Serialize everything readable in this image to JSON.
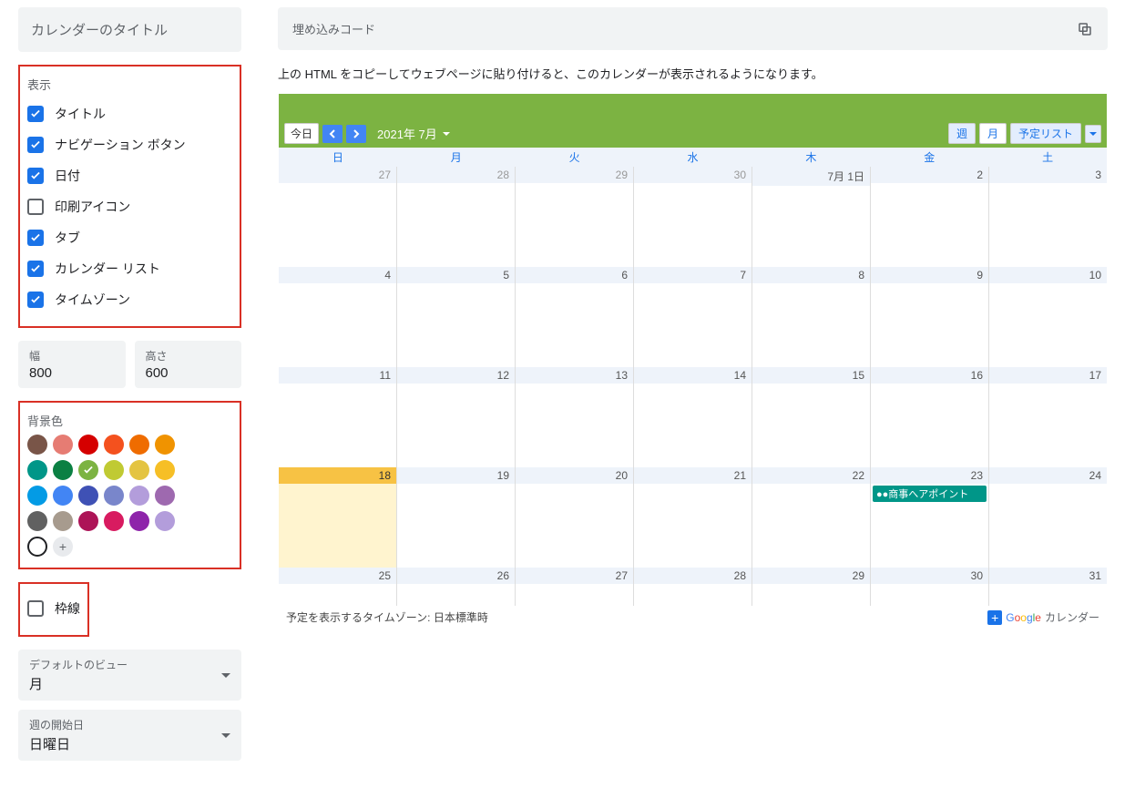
{
  "sidebar": {
    "title_placeholder": "カレンダーのタイトル",
    "display": {
      "heading": "表示",
      "options": [
        {
          "label": "タイトル",
          "checked": true
        },
        {
          "label": "ナビゲーション ボタン",
          "checked": true
        },
        {
          "label": "日付",
          "checked": true
        },
        {
          "label": "印刷アイコン",
          "checked": false
        },
        {
          "label": "タブ",
          "checked": true
        },
        {
          "label": "カレンダー リスト",
          "checked": true
        },
        {
          "label": "タイムゾーン",
          "checked": true
        }
      ]
    },
    "width": {
      "label": "幅",
      "value": "800"
    },
    "height": {
      "label": "高さ",
      "value": "600"
    },
    "bgcolor": {
      "heading": "背景色",
      "colors": [
        "#795548",
        "#e67c73",
        "#d50000",
        "#f4511e",
        "#ef6c00",
        "#f09300",
        "#009688",
        "#0b8043",
        "#7cb342",
        "#c0ca33",
        "#e4c441",
        "#f6bf26",
        "#039be5",
        "#4285f4",
        "#3f51b5",
        "#7986cb",
        "#b39ddb",
        "#9e69af",
        "#616161",
        "#a79b8e",
        "#ad1457",
        "#d81b60",
        "#8e24aa",
        "#b39ddb"
      ],
      "selected_index": 8
    },
    "border": {
      "label": "枠線",
      "checked": false
    },
    "default_view": {
      "label": "デフォルトのビュー",
      "value": "月"
    },
    "week_start": {
      "label": "週の開始日",
      "value": "日曜日"
    }
  },
  "main": {
    "embed_label": "埋め込みコード",
    "hint": "上の HTML をコピーしてウェブページに貼り付けると、このカレンダーが表示されるようになります。"
  },
  "calendar": {
    "today_label": "今日",
    "month_label": "2021年 7月",
    "tabs": {
      "week": "週",
      "month": "月",
      "agenda": "予定リスト"
    },
    "dow": [
      "日",
      "月",
      "火",
      "水",
      "木",
      "金",
      "土"
    ],
    "weeks": [
      [
        {
          "n": "27",
          "other": true
        },
        {
          "n": "28",
          "other": true
        },
        {
          "n": "29",
          "other": true
        },
        {
          "n": "30",
          "other": true
        },
        {
          "n": "7月 1日"
        },
        {
          "n": "2"
        },
        {
          "n": "3"
        }
      ],
      [
        {
          "n": "4"
        },
        {
          "n": "5"
        },
        {
          "n": "6"
        },
        {
          "n": "7"
        },
        {
          "n": "8"
        },
        {
          "n": "9"
        },
        {
          "n": "10"
        }
      ],
      [
        {
          "n": "11"
        },
        {
          "n": "12"
        },
        {
          "n": "13"
        },
        {
          "n": "14"
        },
        {
          "n": "15"
        },
        {
          "n": "16"
        },
        {
          "n": "17"
        }
      ],
      [
        {
          "n": "18",
          "today": true
        },
        {
          "n": "19"
        },
        {
          "n": "20"
        },
        {
          "n": "21"
        },
        {
          "n": "22"
        },
        {
          "n": "23",
          "event": "●●商事へアポイント"
        },
        {
          "n": "24"
        }
      ],
      [
        {
          "n": "25"
        },
        {
          "n": "26"
        },
        {
          "n": "27"
        },
        {
          "n": "28"
        },
        {
          "n": "29"
        },
        {
          "n": "30"
        },
        {
          "n": "31"
        }
      ]
    ],
    "footer_tz": "予定を表示するタイムゾーン: 日本標準時",
    "footer_brand": "カレンダー"
  }
}
